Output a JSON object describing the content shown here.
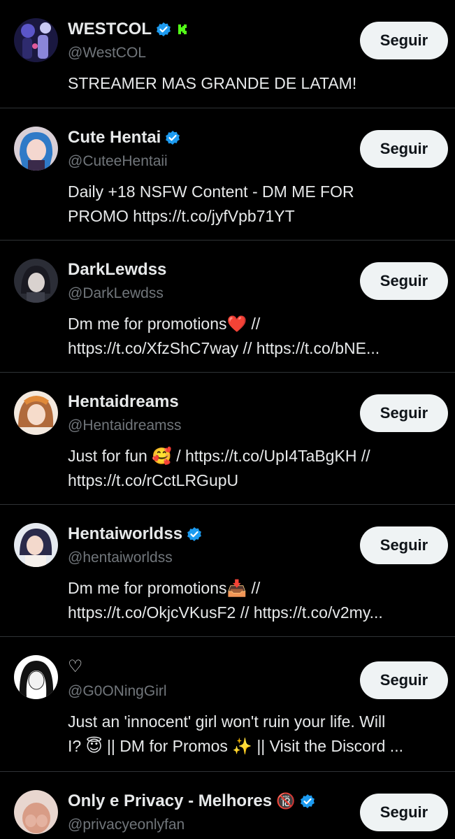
{
  "colors": {
    "background": "#000000",
    "text": "#e7e9ea",
    "secondary_text": "#71767b",
    "verified": "#1d9bf0",
    "kick_green": "#53fc18",
    "button_bg": "#eff3f4",
    "button_text": "#0f1419",
    "divider": "#2f3336"
  },
  "accounts": [
    {
      "name": "WESTCOL",
      "handle": "@WestCOL",
      "bio": [
        "STREAMER MAS GRANDE DE LATAM!"
      ],
      "badges": [
        "verified-icon",
        "kick-icon"
      ],
      "follow_label": "Seguir"
    },
    {
      "name": "Cute Hentai",
      "handle": "@CuteeHentaii",
      "bio": [
        "Daily +18 NSFW Content - DM ME FOR",
        "PROMO https://t.co/jyfVpb71YT"
      ],
      "badges": [
        "verified-icon"
      ],
      "follow_label": "Seguir"
    },
    {
      "name": "DarkLewdss",
      "handle": "@DarkLewdss",
      "bio": [
        "Dm me for promotions❤️ //",
        "https://t.co/XfzShC7way // https://t.co/bNE..."
      ],
      "badges": [],
      "follow_label": "Seguir"
    },
    {
      "name": "Hentaidreams",
      "handle": "@Hentaidreamss",
      "bio": [
        "Just for fun 🥰 / https://t.co/UpI4TaBgKH //",
        "https://t.co/rCctLRGupU"
      ],
      "badges": [],
      "follow_label": "Seguir"
    },
    {
      "name": "Hentaiworldss",
      "handle": "@hentaiworldss",
      "bio": [
        "Dm me for promotions📥 //",
        "https://t.co/OkjcVKusF2 // https://t.co/v2my..."
      ],
      "badges": [
        "verified-icon"
      ],
      "follow_label": "Seguir"
    },
    {
      "name": "♡",
      "handle": "@G0ONingGirl",
      "bio": [
        "Just an 'innocent' girl won't ruin your life. Will",
        "I? 😇 || DM for Promos ✨ || Visit the Discord ..."
      ],
      "badges": [],
      "follow_label": "Seguir"
    },
    {
      "name": "Only e Privacy - Melhores",
      "handle": "@privacyeonlyfan",
      "bio": [],
      "badges": [
        "18-plus-emoji",
        "verified-icon"
      ],
      "badge_text": "🔞",
      "follow_label": "Seguir"
    }
  ]
}
